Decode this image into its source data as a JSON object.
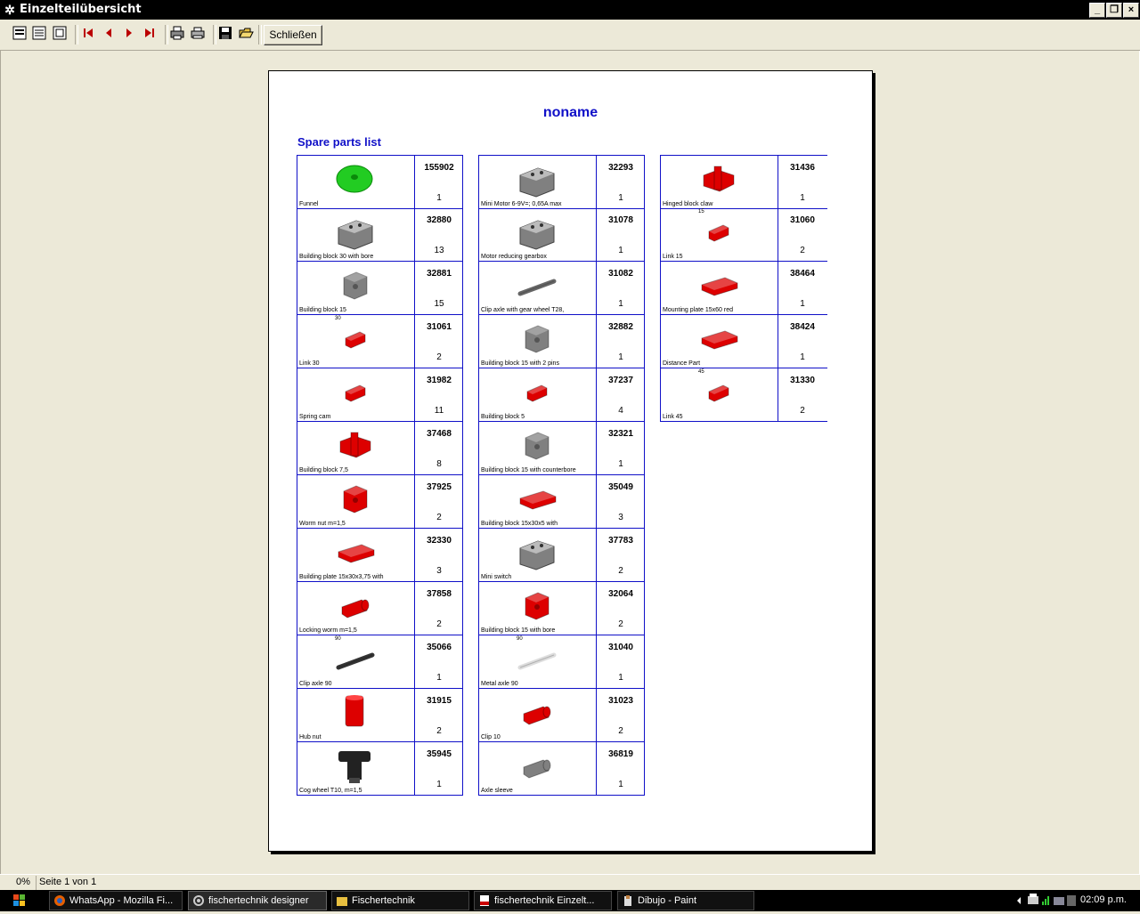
{
  "window": {
    "title": "Einzelteilübersicht"
  },
  "toolbar": {
    "icons": [
      "page-view-icon",
      "list-view-icon",
      "fit-page-icon",
      "first-page-icon",
      "prev-page-icon",
      "next-page-icon",
      "last-page-icon",
      "printer-setup-icon",
      "print-icon",
      "save-icon",
      "open-icon"
    ],
    "close_label": "Schließen"
  },
  "document": {
    "title": "noname",
    "list_title": "Spare parts list",
    "columns": [
      [
        {
          "name": "Funnel",
          "number": "155902",
          "qty": "1",
          "color": "#22cc22",
          "shape": "disc"
        },
        {
          "name": "Building block 30 with bore",
          "number": "32880",
          "qty": "13",
          "color": "#808080",
          "shape": "block"
        },
        {
          "name": "Building block 15",
          "number": "32881",
          "qty": "15",
          "color": "#808080",
          "shape": "cube"
        },
        {
          "name": "Link 30",
          "number": "31061",
          "qty": "2",
          "color": "#dd0000",
          "shape": "small",
          "note": "30"
        },
        {
          "name": "Spring cam",
          "number": "31982",
          "qty": "11",
          "color": "#dd0000",
          "shape": "small"
        },
        {
          "name": "Building block 7,5",
          "number": "37468",
          "qty": "8",
          "color": "#dd0000",
          "shape": "cross"
        },
        {
          "name": "Worm nut m=1,5",
          "number": "37925",
          "qty": "2",
          "color": "#dd0000",
          "shape": "cube"
        },
        {
          "name": "Building plate 15x30x3,75 with",
          "number": "32330",
          "qty": "3",
          "color": "#dd0000",
          "shape": "plate"
        },
        {
          "name": "Locking worm m=1,5",
          "number": "37858",
          "qty": "2",
          "color": "#dd0000",
          "shape": "cyl"
        },
        {
          "name": "Clip axle 90",
          "number": "35066",
          "qty": "1",
          "color": "#333333",
          "shape": "rod",
          "note": "90"
        },
        {
          "name": "Hub nut",
          "number": "31915",
          "qty": "2",
          "color": "#dd0000",
          "shape": "tall"
        },
        {
          "name": "Cog wheel T10, m=1,5",
          "number": "35945",
          "qty": "1",
          "color": "#222222",
          "shape": "cog"
        }
      ],
      [
        {
          "name": "Mini Motor 6-9V=; 0,65A max",
          "number": "32293",
          "qty": "1",
          "color": "#808080",
          "shape": "block"
        },
        {
          "name": "Motor reducing gearbox",
          "number": "31078",
          "qty": "1",
          "color": "#808080",
          "shape": "block"
        },
        {
          "name": "Clip axle with gear wheel T28,",
          "number": "31082",
          "qty": "1",
          "color": "#666666",
          "shape": "rod"
        },
        {
          "name": "Building block 15 with 2 pins",
          "number": "32882",
          "qty": "1",
          "color": "#808080",
          "shape": "cube"
        },
        {
          "name": "Building block 5",
          "number": "37237",
          "qty": "4",
          "color": "#dd0000",
          "shape": "small"
        },
        {
          "name": "Building block 15 with counterbore",
          "number": "32321",
          "qty": "1",
          "color": "#808080",
          "shape": "cube"
        },
        {
          "name": "Building block 15x30x5 with",
          "number": "35049",
          "qty": "3",
          "color": "#dd0000",
          "shape": "plate"
        },
        {
          "name": "Mini switch",
          "number": "37783",
          "qty": "2",
          "color": "#808080",
          "shape": "block"
        },
        {
          "name": "Building block 15 with bore",
          "number": "32064",
          "qty": "2",
          "color": "#dd0000",
          "shape": "cube"
        },
        {
          "name": "Metal axle 90",
          "number": "31040",
          "qty": "1",
          "color": "#dddddd",
          "shape": "rod",
          "note": "90"
        },
        {
          "name": "Clip 10",
          "number": "31023",
          "qty": "2",
          "color": "#dd0000",
          "shape": "cyl"
        },
        {
          "name": "Axle sleeve",
          "number": "36819",
          "qty": "1",
          "color": "#808080",
          "shape": "cyl"
        }
      ],
      [
        {
          "name": "Hinged block claw",
          "number": "31436",
          "qty": "1",
          "color": "#dd0000",
          "shape": "cross"
        },
        {
          "name": "Link 15",
          "number": "31060",
          "qty": "2",
          "color": "#dd0000",
          "shape": "small",
          "note": "15"
        },
        {
          "name": "Mounting plate 15x60 red",
          "number": "38464",
          "qty": "1",
          "color": "#dd0000",
          "shape": "plate"
        },
        {
          "name": "Distance Part",
          "number": "38424",
          "qty": "1",
          "color": "#dd0000",
          "shape": "plate"
        },
        {
          "name": "Link 45",
          "number": "31330",
          "qty": "2",
          "color": "#dd0000",
          "shape": "small",
          "note": "45"
        }
      ]
    ]
  },
  "status": {
    "zoom": "0%",
    "page_info": "Seite 1 von 1"
  },
  "taskbar": {
    "tasks": [
      {
        "label": "WhatsApp - Mozilla Fi...",
        "icon": "firefox-icon"
      },
      {
        "label": "fischertechnik designer",
        "icon": "gear-icon"
      },
      {
        "label": "Fischertechnik",
        "icon": "folder-icon"
      },
      {
        "label": "fischertechnik Einzelt...",
        "icon": "pdf-icon"
      },
      {
        "label": "Dibujo - Paint",
        "icon": "paint-icon"
      }
    ],
    "clock": "02:09 p.m."
  }
}
